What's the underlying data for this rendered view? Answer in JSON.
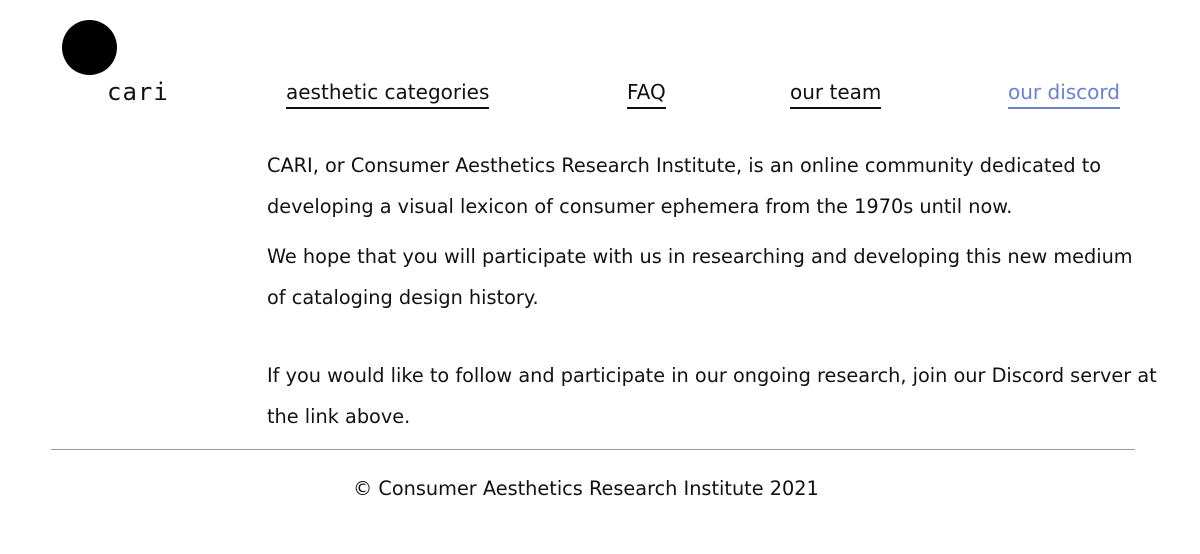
{
  "logo": {
    "text": "cari"
  },
  "nav": {
    "aesthetic_categories": "aesthetic categories",
    "faq": "FAQ",
    "our_team": "our team",
    "our_discord": "our discord"
  },
  "colors": {
    "accent": "#6b7fd7",
    "text": "#111111",
    "divider": "#9a9a9a"
  },
  "content": {
    "paragraphs": [
      "CARI, or Consumer Aesthetics Research Institute, is an online community dedicated to developing a visual lexicon of consumer ephemera from the 1970s until now.",
      "We hope that you will participate with us in researching and developing this new medium of cataloging design history.",
      "If you would like to follow and participate in our ongoing research, join our Discord server at the link above."
    ]
  },
  "footer": {
    "copyright": "© Consumer Aesthetics Research Institute 2021"
  }
}
